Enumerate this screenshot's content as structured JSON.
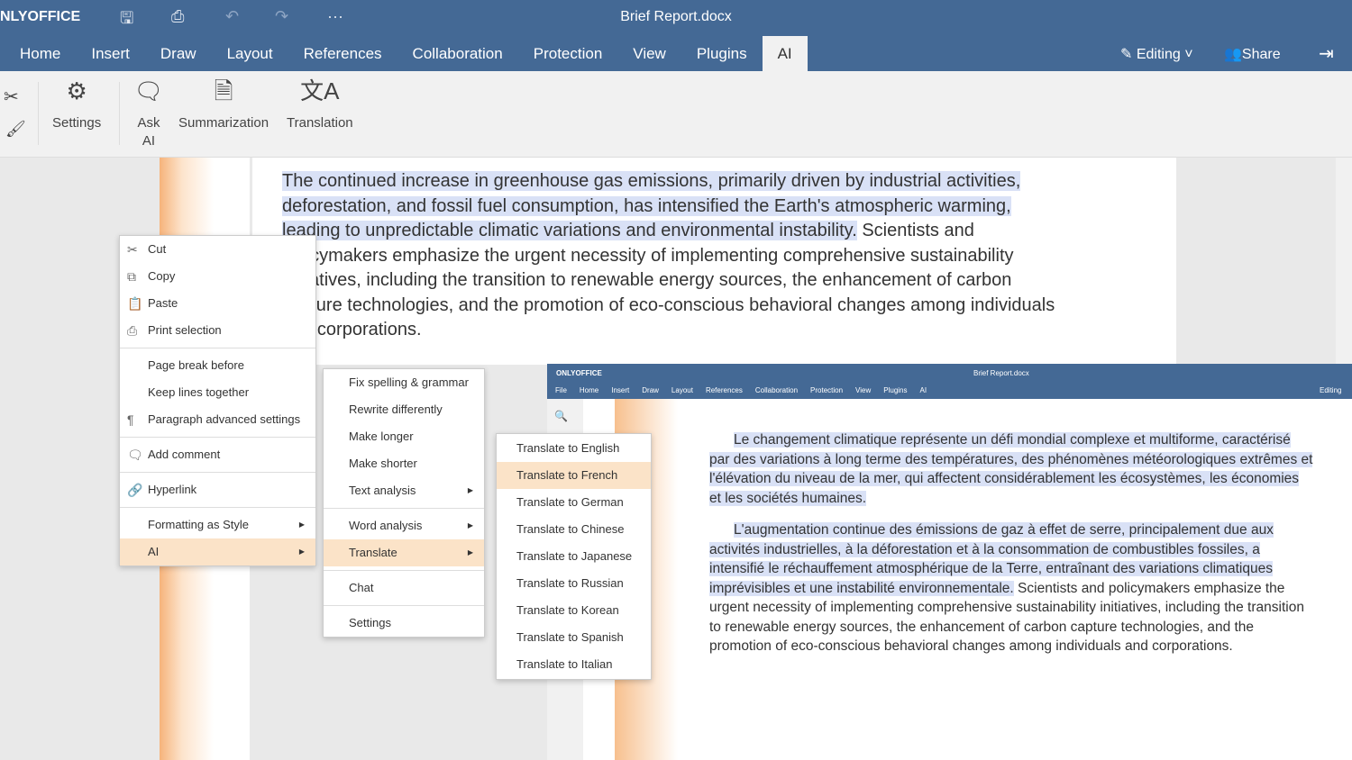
{
  "header": {
    "logo": "NLYOFFICE",
    "title": "Brief Report.docx",
    "editing": "Editing",
    "share": "Share",
    "tabs": [
      "Home",
      "Insert",
      "Draw",
      "Layout",
      "References",
      "Collaboration",
      "Protection",
      "View",
      "Plugins",
      "AI"
    ]
  },
  "toolbar": {
    "settings": "Settings",
    "ask_ai": "Ask AI",
    "summarization": "Summarization",
    "translation": "Translation"
  },
  "document": {
    "p1_hl": "The continued increase in greenhouse gas emissions, primarily driven by industrial activities, deforestation, and fossil fuel consumption, has intensified the Earth's atmospheric warming, leading to unpredictable climatic variations and environmental instability.",
    "p1_rest": " Scientists and policymakers emphasize the urgent necessity of implementing comprehensive sustainability initiatives, including the transition to renewable energy sources, the enhancement of carbon capture technologies, and the promotion of eco-conscious behavioral changes among individuals and corporations."
  },
  "context_menu": {
    "items": [
      "Cut",
      "Copy",
      "Paste",
      "Print selection",
      "Page break before",
      "Keep lines together",
      "Paragraph advanced settings",
      "Add comment",
      "Hyperlink",
      "Formatting as Style",
      "AI"
    ]
  },
  "ai_menu": {
    "items": [
      "Fix spelling & grammar",
      "Rewrite differently",
      "Make longer",
      "Make shorter",
      "Text analysis",
      "Word analysis",
      "Translate",
      "Chat",
      "Settings"
    ]
  },
  "translate_menu": {
    "items": [
      "Translate to English",
      "Translate to French",
      "Translate to German",
      "Translate to Chinese",
      "Translate to Japanese",
      "Translate to Russian",
      "Translate to Korean",
      "Translate to Spanish",
      "Translate to Italian"
    ]
  },
  "inset": {
    "logo": "ONLYOFFICE",
    "title": "Brief Report.docx",
    "editing": "Editing",
    "tabs": [
      "File",
      "Home",
      "Insert",
      "Draw",
      "Layout",
      "References",
      "Collaboration",
      "Protection",
      "View",
      "Plugins",
      "AI"
    ],
    "p1": "Le changement climatique représente un défi mondial complexe et multiforme, caractérisé par des variations à long terme des températures, des phénomènes météorologiques extrêmes et l'élévation du niveau de la mer, qui affectent considérablement les écosystèmes, les économies et les sociétés humaines.",
    "p2_hl": "L'augmentation continue des émissions de gaz à effet de serre, principalement due aux activités industrielles, à la déforestation et à la consommation de combustibles fossiles, a intensifié le réchauffement atmosphérique de la Terre, entraînant des variations climatiques imprévisibles et une instabilité environnementale.",
    "p2_rest": " Scientists and policymakers emphasize the urgent necessity of implementing comprehensive sustainability initiatives, including the transition to renewable energy sources, the enhancement of carbon capture technologies, and the promotion of eco-conscious behavioral changes among individuals and corporations."
  }
}
